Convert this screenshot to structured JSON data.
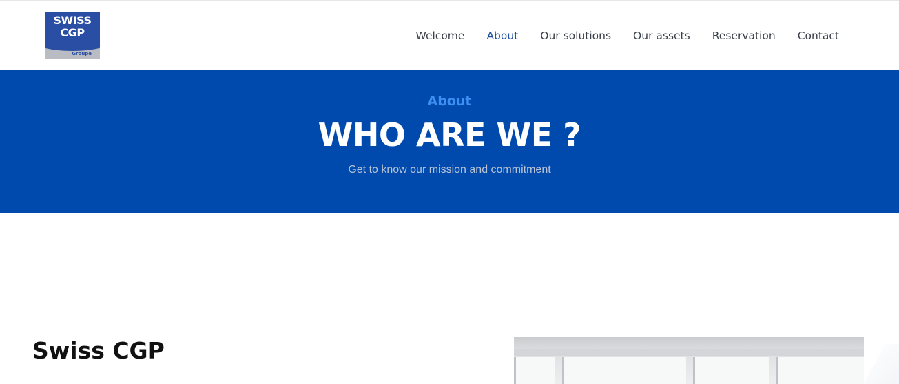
{
  "header": {
    "logo": {
      "line1": "SWISS",
      "line2": "CGP",
      "sub": "Groupe"
    },
    "nav": [
      {
        "label": "Welcome",
        "active": false
      },
      {
        "label": "About",
        "active": true
      },
      {
        "label": "Our solutions",
        "active": false
      },
      {
        "label": "Our assets",
        "active": false
      },
      {
        "label": "Reservation",
        "active": false
      },
      {
        "label": "Contact",
        "active": false
      }
    ]
  },
  "hero": {
    "eyebrow": "About",
    "title": "WHO ARE WE ?",
    "subtitle": "Get to know our mission and commitment"
  },
  "content": {
    "section_title": "Swiss CGP"
  },
  "colors": {
    "brand_blue": "#004aad",
    "nav_active": "#1d4e9e",
    "eyebrow": "#3d8ff2"
  }
}
